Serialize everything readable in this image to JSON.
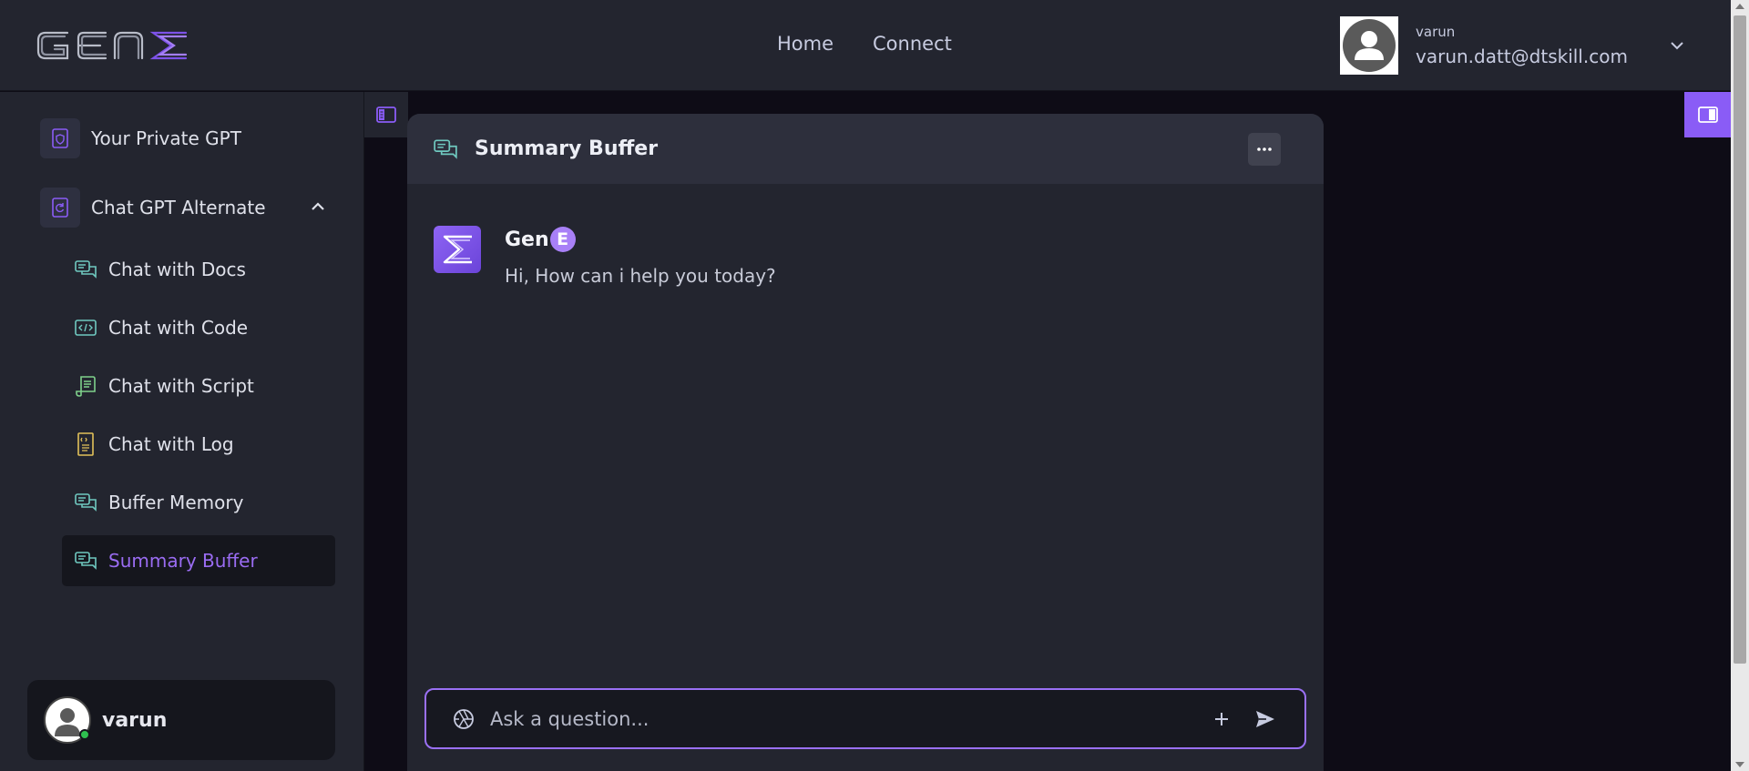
{
  "header": {
    "logo_text": "GENΣ",
    "nav": [
      {
        "label": "Home"
      },
      {
        "label": "Connect"
      }
    ],
    "account": {
      "name": "varun",
      "email": "varun.datt@dtskill.com"
    }
  },
  "sidebar": {
    "top_items": [
      {
        "label": "Your Private GPT",
        "icon": "shield-doc-icon"
      },
      {
        "label": "Chat GPT Alternate",
        "icon": "refresh-doc-icon",
        "expanded": true
      }
    ],
    "sub_items": [
      {
        "label": "Chat with Docs",
        "icon": "chat-bubbles-icon"
      },
      {
        "label": "Chat with Code",
        "icon": "code-window-icon"
      },
      {
        "label": "Chat with Script",
        "icon": "script-scroll-icon"
      },
      {
        "label": "Chat with Log",
        "icon": "log-file-icon"
      },
      {
        "label": "Buffer Memory",
        "icon": "chat-bubbles-icon"
      },
      {
        "label": "Summary Buffer",
        "icon": "chat-bubbles-icon",
        "active": true
      }
    ],
    "user": {
      "name": "varun",
      "status": "online"
    }
  },
  "chat": {
    "title": "Summary Buffer",
    "messages": [
      {
        "sender": "Gen",
        "sender_badge": "E",
        "text": "Hi, How can i help you today?"
      }
    ],
    "composer": {
      "placeholder": "Ask a question..."
    }
  },
  "colors": {
    "accent": "#8a5cf6",
    "active_text": "#9a6cf2",
    "panel": "#23252f",
    "background": "#0e0c16"
  }
}
